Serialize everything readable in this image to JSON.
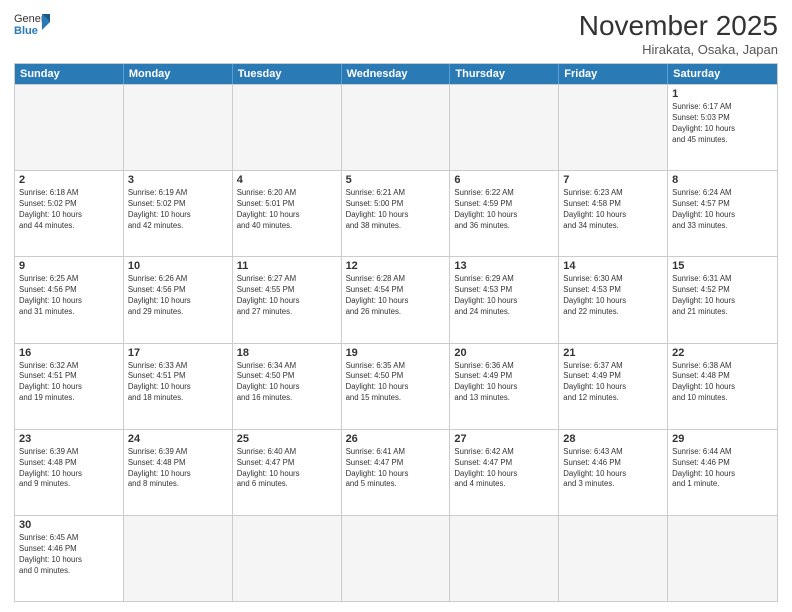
{
  "logo": {
    "general": "General",
    "blue": "Blue"
  },
  "header": {
    "title": "November 2025",
    "subtitle": "Hirakata, Osaka, Japan"
  },
  "weekdays": [
    "Sunday",
    "Monday",
    "Tuesday",
    "Wednesday",
    "Thursday",
    "Friday",
    "Saturday"
  ],
  "rows": [
    [
      {
        "day": "",
        "info": ""
      },
      {
        "day": "",
        "info": ""
      },
      {
        "day": "",
        "info": ""
      },
      {
        "day": "",
        "info": ""
      },
      {
        "day": "",
        "info": ""
      },
      {
        "day": "",
        "info": ""
      },
      {
        "day": "1",
        "info": "Sunrise: 6:17 AM\nSunset: 5:03 PM\nDaylight: 10 hours\nand 45 minutes."
      }
    ],
    [
      {
        "day": "2",
        "info": "Sunrise: 6:18 AM\nSunset: 5:02 PM\nDaylight: 10 hours\nand 44 minutes."
      },
      {
        "day": "3",
        "info": "Sunrise: 6:19 AM\nSunset: 5:02 PM\nDaylight: 10 hours\nand 42 minutes."
      },
      {
        "day": "4",
        "info": "Sunrise: 6:20 AM\nSunset: 5:01 PM\nDaylight: 10 hours\nand 40 minutes."
      },
      {
        "day": "5",
        "info": "Sunrise: 6:21 AM\nSunset: 5:00 PM\nDaylight: 10 hours\nand 38 minutes."
      },
      {
        "day": "6",
        "info": "Sunrise: 6:22 AM\nSunset: 4:59 PM\nDaylight: 10 hours\nand 36 minutes."
      },
      {
        "day": "7",
        "info": "Sunrise: 6:23 AM\nSunset: 4:58 PM\nDaylight: 10 hours\nand 34 minutes."
      },
      {
        "day": "8",
        "info": "Sunrise: 6:24 AM\nSunset: 4:57 PM\nDaylight: 10 hours\nand 33 minutes."
      }
    ],
    [
      {
        "day": "9",
        "info": "Sunrise: 6:25 AM\nSunset: 4:56 PM\nDaylight: 10 hours\nand 31 minutes."
      },
      {
        "day": "10",
        "info": "Sunrise: 6:26 AM\nSunset: 4:56 PM\nDaylight: 10 hours\nand 29 minutes."
      },
      {
        "day": "11",
        "info": "Sunrise: 6:27 AM\nSunset: 4:55 PM\nDaylight: 10 hours\nand 27 minutes."
      },
      {
        "day": "12",
        "info": "Sunrise: 6:28 AM\nSunset: 4:54 PM\nDaylight: 10 hours\nand 26 minutes."
      },
      {
        "day": "13",
        "info": "Sunrise: 6:29 AM\nSunset: 4:53 PM\nDaylight: 10 hours\nand 24 minutes."
      },
      {
        "day": "14",
        "info": "Sunrise: 6:30 AM\nSunset: 4:53 PM\nDaylight: 10 hours\nand 22 minutes."
      },
      {
        "day": "15",
        "info": "Sunrise: 6:31 AM\nSunset: 4:52 PM\nDaylight: 10 hours\nand 21 minutes."
      }
    ],
    [
      {
        "day": "16",
        "info": "Sunrise: 6:32 AM\nSunset: 4:51 PM\nDaylight: 10 hours\nand 19 minutes."
      },
      {
        "day": "17",
        "info": "Sunrise: 6:33 AM\nSunset: 4:51 PM\nDaylight: 10 hours\nand 18 minutes."
      },
      {
        "day": "18",
        "info": "Sunrise: 6:34 AM\nSunset: 4:50 PM\nDaylight: 10 hours\nand 16 minutes."
      },
      {
        "day": "19",
        "info": "Sunrise: 6:35 AM\nSunset: 4:50 PM\nDaylight: 10 hours\nand 15 minutes."
      },
      {
        "day": "20",
        "info": "Sunrise: 6:36 AM\nSunset: 4:49 PM\nDaylight: 10 hours\nand 13 minutes."
      },
      {
        "day": "21",
        "info": "Sunrise: 6:37 AM\nSunset: 4:49 PM\nDaylight: 10 hours\nand 12 minutes."
      },
      {
        "day": "22",
        "info": "Sunrise: 6:38 AM\nSunset: 4:48 PM\nDaylight: 10 hours\nand 10 minutes."
      }
    ],
    [
      {
        "day": "23",
        "info": "Sunrise: 6:39 AM\nSunset: 4:48 PM\nDaylight: 10 hours\nand 9 minutes."
      },
      {
        "day": "24",
        "info": "Sunrise: 6:39 AM\nSunset: 4:48 PM\nDaylight: 10 hours\nand 8 minutes."
      },
      {
        "day": "25",
        "info": "Sunrise: 6:40 AM\nSunset: 4:47 PM\nDaylight: 10 hours\nand 6 minutes."
      },
      {
        "day": "26",
        "info": "Sunrise: 6:41 AM\nSunset: 4:47 PM\nDaylight: 10 hours\nand 5 minutes."
      },
      {
        "day": "27",
        "info": "Sunrise: 6:42 AM\nSunset: 4:47 PM\nDaylight: 10 hours\nand 4 minutes."
      },
      {
        "day": "28",
        "info": "Sunrise: 6:43 AM\nSunset: 4:46 PM\nDaylight: 10 hours\nand 3 minutes."
      },
      {
        "day": "29",
        "info": "Sunrise: 6:44 AM\nSunset: 4:46 PM\nDaylight: 10 hours\nand 1 minute."
      }
    ],
    [
      {
        "day": "30",
        "info": "Sunrise: 6:45 AM\nSunset: 4:46 PM\nDaylight: 10 hours\nand 0 minutes."
      },
      {
        "day": "",
        "info": ""
      },
      {
        "day": "",
        "info": ""
      },
      {
        "day": "",
        "info": ""
      },
      {
        "day": "",
        "info": ""
      },
      {
        "day": "",
        "info": ""
      },
      {
        "day": "",
        "info": ""
      }
    ]
  ]
}
